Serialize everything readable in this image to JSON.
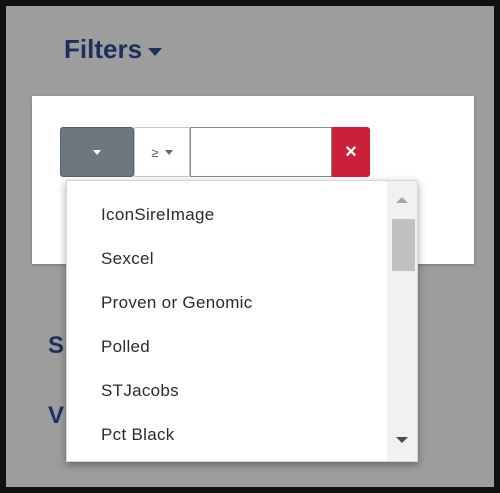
{
  "header": {
    "title": "Filters",
    "caret_icon": "caret-down-icon"
  },
  "filter_row": {
    "column_select_icon": "caret-down-icon",
    "operator": "≥",
    "operator_icon": "caret-down-icon",
    "value": "",
    "clear_label": "×",
    "clear_color": "#c9213a"
  },
  "dropdown": {
    "options": [
      "IconSireImage",
      "Sexcel",
      "Proven or Genomic",
      "Polled",
      "STJacobs",
      "Pct Black"
    ],
    "scroll_up_icon": "arrow-up-icon",
    "scroll_down_icon": "arrow-down-icon"
  },
  "background_peek": {
    "letter_s": "S",
    "letter_v": "V"
  },
  "colors": {
    "title": "#1f2f5c",
    "background": "#9d9d9d",
    "select_button": "#6e7780"
  }
}
